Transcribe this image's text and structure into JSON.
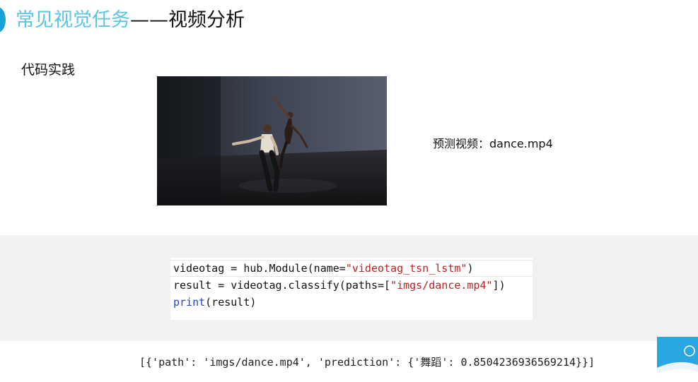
{
  "slide": {
    "title_accent": "常见视觉任务",
    "title_dash": "——",
    "title_main": "视频分析",
    "section_label": "代码实践"
  },
  "video": {
    "caption": "预测视频：dance.mp4"
  },
  "code": {
    "line1": {
      "before": "videotag = hub.Module(name=",
      "str": "\"videotag_tsn_lstm\"",
      "after": ")"
    },
    "line2": {
      "before": "result = videotag.classify(paths=[",
      "str": "\"imgs/dance.mp4\"",
      "after": "])"
    },
    "line3": {
      "kw": "print",
      "after": "(result)"
    }
  },
  "output": {
    "text": "[{'path': 'imgs/dance.mp4', 'prediction': {'舞蹈': 0.8504236936569214}}]"
  },
  "colors": {
    "accent": "#5cc4e6",
    "bullet": "#1aa3d9",
    "string": "#ba2121",
    "keyword": "#2b46b8"
  }
}
